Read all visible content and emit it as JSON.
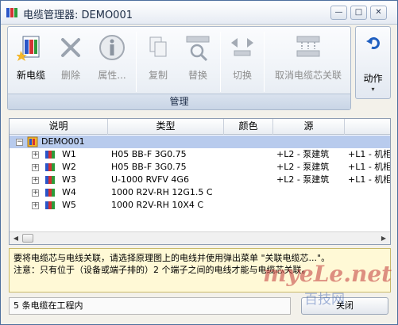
{
  "window": {
    "title": "电缆管理器: DEMO001"
  },
  "title_buttons": {
    "minimize": "—",
    "maximize": "□",
    "close": "✕"
  },
  "ribbon": {
    "buttons": [
      {
        "label": "新电缆",
        "icon": "new-cable-icon",
        "enabled": true
      },
      {
        "label": "删除",
        "icon": "delete-icon",
        "enabled": false
      },
      {
        "label": "属性...",
        "icon": "info-icon",
        "enabled": false
      },
      {
        "label": "复制",
        "icon": "copy-icon",
        "enabled": false
      },
      {
        "label": "替换",
        "icon": "replace-icon",
        "enabled": false
      },
      {
        "label": "切换",
        "icon": "switch-icon",
        "enabled": false
      },
      {
        "label": "取消电缆芯关联",
        "icon": "disassociate-core-icon",
        "enabled": false
      }
    ],
    "group_label": "管理",
    "action": {
      "label": "动作",
      "caret": "▾"
    }
  },
  "grid": {
    "headers": [
      "说明",
      "类型",
      "颜色",
      "源",
      ""
    ],
    "root": {
      "name": "DEMO001",
      "expander": "−"
    },
    "rows": [
      {
        "name": "W1",
        "type": "H05 BB-F 3G0.75",
        "color": "",
        "source": "+L2 - 泵建筑",
        "dest": "+L1 - 机柜"
      },
      {
        "name": "W2",
        "type": "H05 BB-F 3G0.75",
        "color": "",
        "source": "+L2 - 泵建筑",
        "dest": "+L1 - 机柜"
      },
      {
        "name": "W3",
        "type": "U-1000 RVFV 4G6",
        "color": "",
        "source": "+L2 - 泵建筑",
        "dest": "+L1 - 机柜"
      },
      {
        "name": "W4",
        "type": "1000 R2V-RH 12G1.5 C",
        "color": "",
        "source": "",
        "dest": ""
      },
      {
        "name": "W5",
        "type": "1000 R2V-RH 10X4 C",
        "color": "",
        "source": "",
        "dest": ""
      }
    ],
    "row_expander": "+"
  },
  "info": {
    "line1": "要将电缆芯与电线关联，请选择原理图上的电线并使用弹出菜单 \"关联电缆芯...\"。",
    "line2": "注意：只有位于（设备或端子排的）2 个端子之间的电线才能与电缆芯关联。"
  },
  "status": {
    "text": "5 条电缆在工程内"
  },
  "close_button": {
    "label": "关闭"
  },
  "watermark": {
    "text": "myeLe.net",
    "sub": "百技网"
  }
}
